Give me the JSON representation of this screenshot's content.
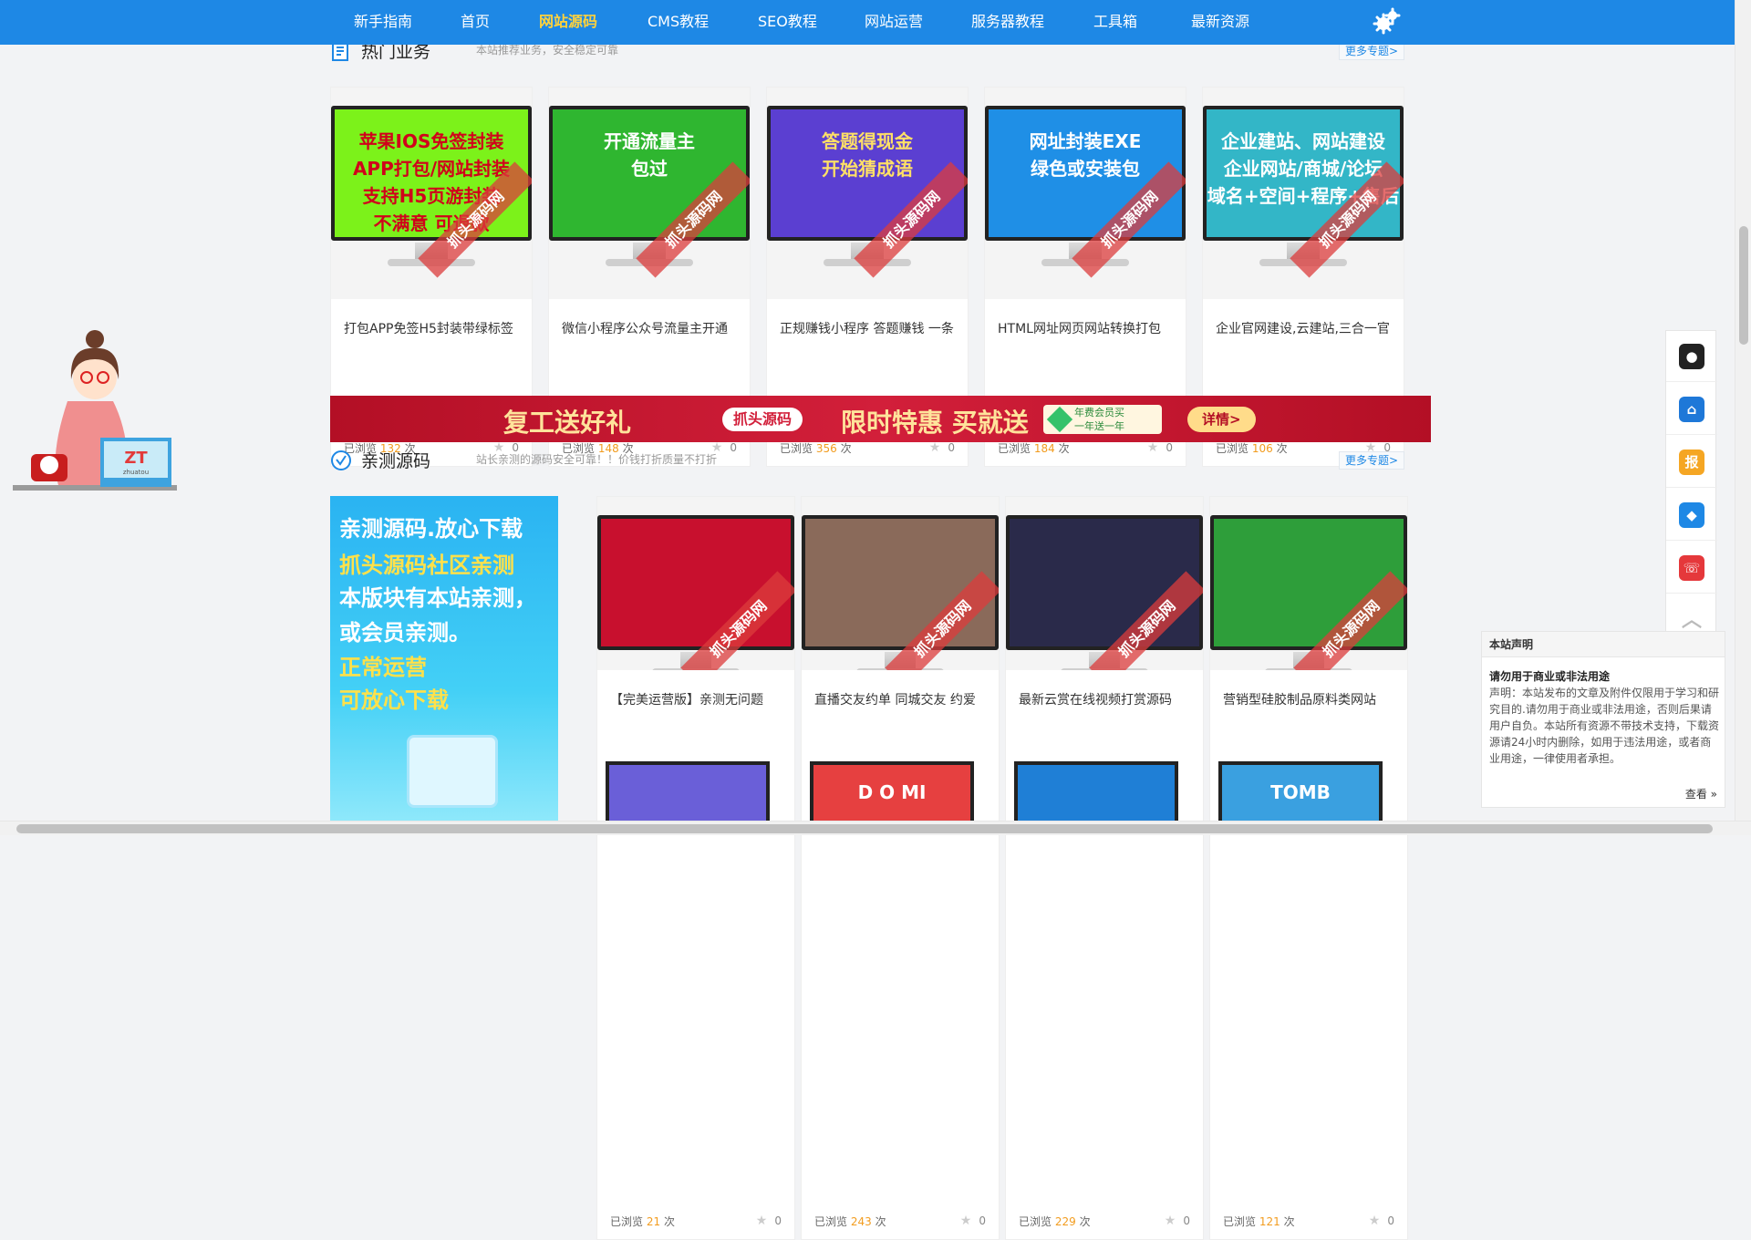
{
  "nav": {
    "items": [
      {
        "label": "新手指南",
        "active": false
      },
      {
        "label": "首页",
        "active": false
      },
      {
        "label": "网站源码",
        "active": true
      },
      {
        "label": "CMS教程",
        "active": false
      },
      {
        "label": "SEO教程",
        "active": false
      },
      {
        "label": "网站运营",
        "active": false
      },
      {
        "label": "服务器教程",
        "active": false
      },
      {
        "label": "工具箱",
        "active": false
      },
      {
        "label": "最新资源",
        "active": false
      }
    ],
    "settings_icon": "gear-icon"
  },
  "hot": {
    "title": "热门业务",
    "subtitle": "本站推荐业务，安全稳定可靠",
    "more": "更多专题>",
    "cards": [
      {
        "name": "打包APP免签H5封装带绿标签",
        "views_prefix": "已浏览",
        "views": "132",
        "views_suffix": "次",
        "likes": "0",
        "screen_text": "苹果IOS免签封装\nAPP打包/网站封装\n支持H5页游封装\n不满意 可退款",
        "screen_bg": "#7cf21a",
        "screen_fg": "#d0021b"
      },
      {
        "name": "微信小程序公众号流量主开通",
        "views_prefix": "已浏览",
        "views": "148",
        "views_suffix": "次",
        "likes": "0",
        "screen_text": "开通流量主\n包过",
        "screen_bg": "#2fb630",
        "screen_fg": "#ffffff"
      },
      {
        "name": "正规赚钱小程序 答题赚钱 一条",
        "views_prefix": "已浏览",
        "views": "356",
        "views_suffix": "次",
        "likes": "0",
        "screen_text": "答题得现金\n开始猜成语",
        "screen_bg": "#5b3fd1",
        "screen_fg": "#ffe066"
      },
      {
        "name": "HTML网址网页网站转换打包",
        "views_prefix": "已浏览",
        "views": "184",
        "views_suffix": "次",
        "likes": "0",
        "screen_text": "网址封装EXE\n绿色或安装包",
        "screen_bg": "#1f8fe6",
        "screen_fg": "#ffffff"
      },
      {
        "name": "企业官网建设,云建站,三合一官",
        "views_prefix": "已浏览",
        "views": "106",
        "views_suffix": "次",
        "likes": "0",
        "screen_text": "企业建站、网站建设\n企业网站/商城/论坛\n域名+空间+程序+售后",
        "screen_bg": "#33b6c7",
        "screen_fg": "#ffffff"
      }
    ]
  },
  "banner": {
    "left_text": "复工送好礼",
    "tag": "抓头源码",
    "right_text": "限时特惠 买就送",
    "vip": "年费会员买\n一年送一年",
    "detail": "详情>"
  },
  "tested": {
    "title": "亲测源码",
    "subtitle": "站长亲测的源码安全可靠！！价钱打折质量不打折",
    "more": "更多专题>",
    "promo_lines": [
      {
        "text": "亲测源码.放心下载",
        "color": "#ffffff"
      },
      {
        "text": "抓头源码社区亲测",
        "color": "#ffe14a"
      },
      {
        "text": "本版块有本站亲测，",
        "color": "#ffffff"
      },
      {
        "text": "或会员亲测。",
        "color": "#ffffff"
      },
      {
        "text": "正常运营",
        "color": "#ffe14a"
      },
      {
        "text": "可放心下载",
        "color": "#ffe14a"
      }
    ],
    "cards": [
      {
        "name": "【完美运营版】亲测无问题",
        "views_prefix": "已浏览",
        "views": "21",
        "views_suffix": "次",
        "likes": "0",
        "screen_bg": "#c8102e"
      },
      {
        "name": "直播交友约单 同城交友 约爱",
        "views_prefix": "已浏览",
        "views": "243",
        "views_suffix": "次",
        "likes": "0",
        "screen_bg": "#8a6a5a"
      },
      {
        "name": "最新云赏在线视频打赏源码",
        "views_prefix": "已浏览",
        "views": "229",
        "views_suffix": "次",
        "likes": "0",
        "screen_bg": "#2a2a4a"
      },
      {
        "name": "营销型硅胶制品原料类网站",
        "views_prefix": "已浏览",
        "views": "121",
        "views_suffix": "次",
        "likes": "0",
        "screen_bg": "#2e9e3a"
      }
    ],
    "row2_screens": [
      {
        "screen_bg": "#6a5fd8"
      },
      {
        "screen_bg": "#e64040",
        "screen_text": "D O MI"
      },
      {
        "screen_bg": "#1f7fd6"
      },
      {
        "screen_bg": "#3aa0e0",
        "screen_text": "TOMB"
      }
    ]
  },
  "watermark": "抓头源码网",
  "support_badge": {
    "logo": "ZT",
    "sub": "zhuatou"
  },
  "right_buttons": [
    {
      "name": "customer-service",
      "icon": "agent-icon",
      "glyph": "●",
      "color": "#222222"
    },
    {
      "name": "home",
      "icon": "home-icon",
      "glyph": "⌂",
      "color": "#1e78d8"
    },
    {
      "name": "report",
      "icon": "report-icon",
      "glyph": "报",
      "color": "#f5a623"
    },
    {
      "name": "vip",
      "icon": "diamond-icon",
      "glyph": "◆",
      "color": "#1e88e5"
    },
    {
      "name": "contact",
      "icon": "phone-icon",
      "glyph": "☏",
      "color": "#e5383b"
    },
    {
      "name": "back-to-top",
      "icon": "chevron-up-icon",
      "glyph": "︿",
      "color": "#bbbbbb"
    }
  ],
  "notice": {
    "title": "本站声明",
    "heading": "请勿用于商业或非法用途",
    "body": "声明：本站发布的文章及附件仅限用于学习和研究目的.请勿用于商业或非法用途，否则后果请用户自负。本站所有资源不带技术支持，下载资源请24小时内删除，如用于违法用途，或者商业用途，一律使用者承担。",
    "more": "查看 »"
  }
}
